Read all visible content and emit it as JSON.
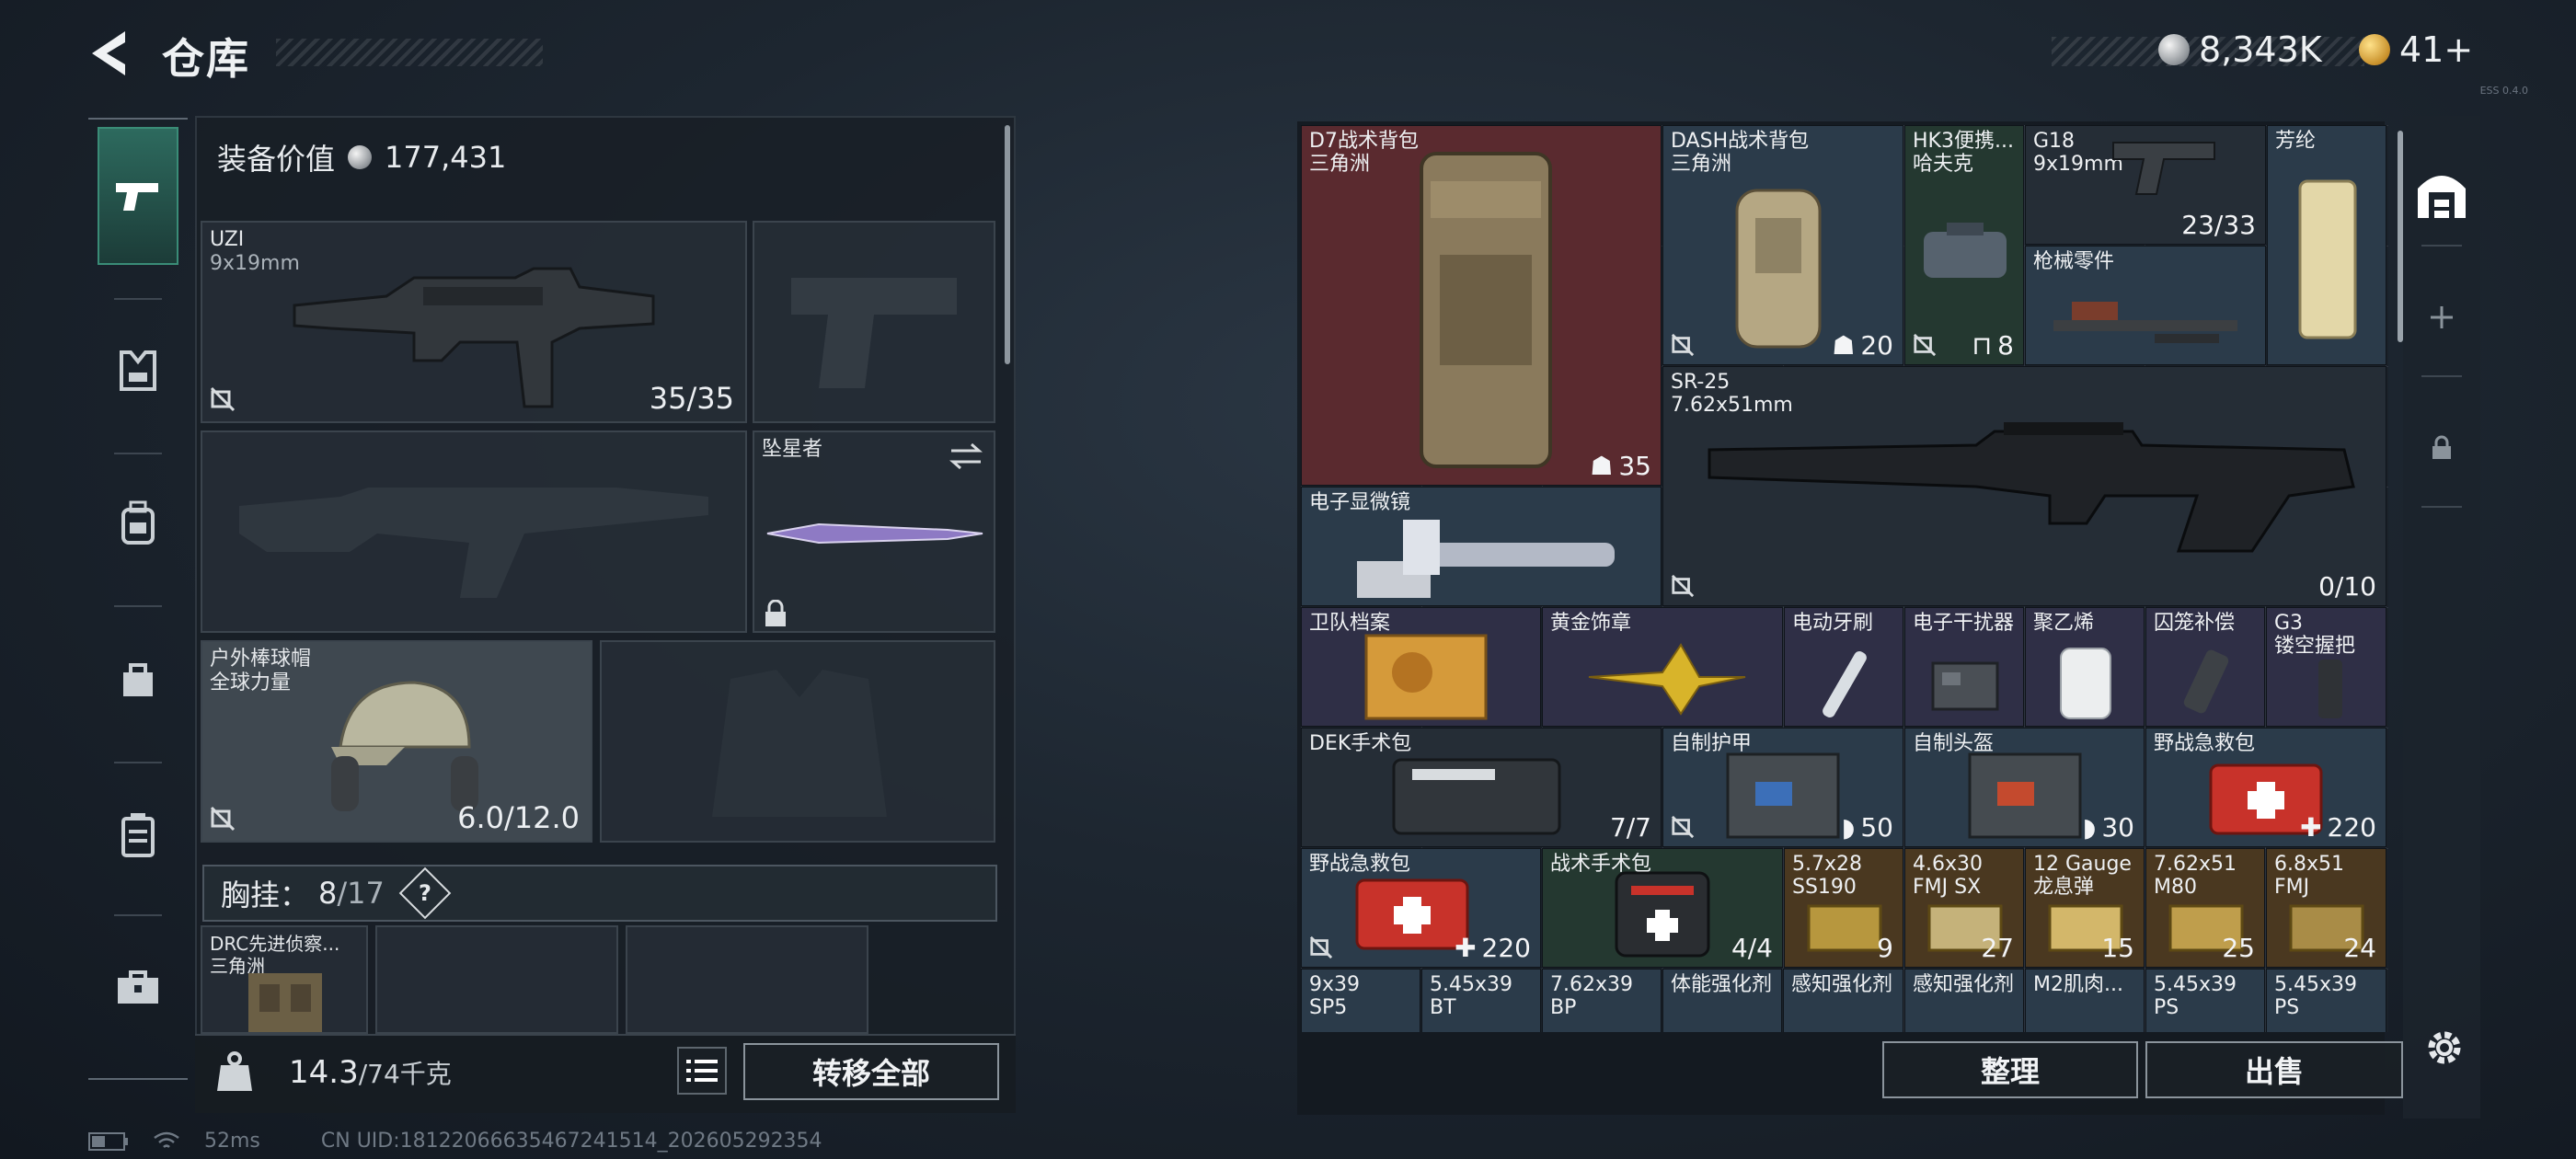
{
  "header": {
    "title": "仓库",
    "currency_silver": "8,343K",
    "currency_gold": "41+",
    "version": "ESS 0.4.0"
  },
  "left_rail": {
    "items": [
      "weapons",
      "armor-vest",
      "backpack",
      "bag",
      "case",
      "toolbox"
    ]
  },
  "equipment": {
    "value_label": "装备价值",
    "value": "177,431",
    "primary": {
      "name": "UZI",
      "ammo": "9x19mm",
      "count": "35/35"
    },
    "melee": {
      "name": "坠星者"
    },
    "helmet": {
      "name": "户外棒球帽",
      "brand": "全球力量",
      "durability": "6.0/12.0"
    },
    "chest_rig": {
      "label": "胸挂：",
      "current": "8",
      "total": "/17",
      "help": "?"
    },
    "chest_item": {
      "name": "DRC先进侦察...",
      "brand": "三角洲"
    },
    "weight_current": "14.3",
    "weight_total": "/74千克",
    "transfer_all": "转移全部"
  },
  "warehouse": {
    "items": [
      {
        "name": "D7战术背包\n三角洲",
        "badge": "35",
        "badge_icon": "backpack-capacity-icon",
        "tint": "red"
      },
      {
        "name": "DASH战术背包\n三角洲",
        "badge": "20",
        "badge_icon": "backpack-capacity-icon",
        "tint": "blue"
      },
      {
        "name": "HK3便携...\n哈夫克",
        "badge": "8",
        "badge_icon": "vest-capacity-icon",
        "tint": "green"
      },
      {
        "name": "G18\n9x19mm",
        "badge": "23/33",
        "tint": "dark"
      },
      {
        "name": "芳纶",
        "tint": "blue"
      },
      {
        "name": "枪械零件",
        "tint": "blue"
      },
      {
        "name": "SR-25\n7.62x51mm",
        "badge": "0/10",
        "tint": "dark"
      },
      {
        "name": "电子显微镜",
        "tint": "blue"
      },
      {
        "name": "卫队档案",
        "tint": "purple"
      },
      {
        "name": "黄金饰章",
        "tint": "purple"
      },
      {
        "name": "电动牙刷",
        "tint": "purple"
      },
      {
        "name": "电子干扰器",
        "tint": "purple"
      },
      {
        "name": "聚乙烯",
        "tint": "purple"
      },
      {
        "name": "囚笼补偿",
        "tint": "purple"
      },
      {
        "name": "G3\n镂空握把",
        "tint": "purple"
      },
      {
        "name": "DEK手术包",
        "badge": "7/7",
        "tint": "dark"
      },
      {
        "name": "自制护甲",
        "badge": "50",
        "badge_icon": "armor-durability-icon",
        "tint": "blue"
      },
      {
        "name": "自制头盔",
        "badge": "30",
        "badge_icon": "armor-durability-icon",
        "tint": "blue"
      },
      {
        "name": "野战急救包",
        "badge": "220",
        "badge_icon": "health-plus-icon",
        "tint": "blue"
      },
      {
        "name": "野战急救包",
        "badge": "220",
        "badge_icon": "health-plus-icon",
        "tint": "blue"
      },
      {
        "name": "战术手术包",
        "badge": "4/4",
        "tint": "green"
      },
      {
        "name": "5.7x28\nSS190",
        "badge": "9",
        "tint": "gold"
      },
      {
        "name": "4.6x30\nFMJ SX",
        "badge": "27",
        "tint": "gold"
      },
      {
        "name": "12 Gauge\n龙息弹",
        "badge": "15",
        "tint": "gold"
      },
      {
        "name": "7.62x51\nM80",
        "badge": "25",
        "tint": "gold"
      },
      {
        "name": "6.8x51\nFMJ",
        "badge": "24",
        "tint": "gold"
      },
      {
        "name": "9x39\nSP5",
        "tint": "blue"
      },
      {
        "name": "5.45x39\nBT",
        "tint": "blue"
      },
      {
        "name": "7.62x39\nBP",
        "tint": "blue"
      },
      {
        "name": "体能强化剂",
        "tint": "blue"
      },
      {
        "name": "感知强化剂",
        "tint": "blue"
      },
      {
        "name": "感知强化剂",
        "tint": "blue"
      },
      {
        "name": "M2肌肉...",
        "tint": "blue"
      },
      {
        "name": "5.45x39\nPS",
        "tint": "blue"
      },
      {
        "name": "5.45x39\nPS",
        "tint": "blue"
      }
    ],
    "sort_label": "整理",
    "sell_label": "出售"
  },
  "right_rail": {
    "items": [
      "warehouse-icon",
      "add-icon",
      "lock-icon"
    ]
  },
  "status": {
    "ping": "52ms",
    "uid": "CN UID:18122066635467241514_202605292354"
  },
  "colors": {
    "accent_green": "#3a8c77",
    "tint_red": "#5a2a2f",
    "tint_blue": "#2b3b4a",
    "tint_gold": "#4a3820"
  }
}
